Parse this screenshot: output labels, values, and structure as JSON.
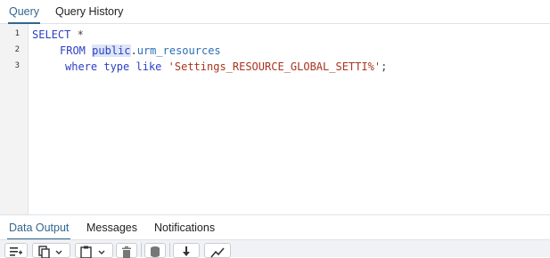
{
  "tabs": {
    "query": "Query",
    "query_history": "Query History"
  },
  "editor": {
    "line_numbers": [
      "1",
      "2",
      "3"
    ],
    "line1": {
      "kw": "SELECT",
      "rest": " *"
    },
    "line2": {
      "kw": "FROM",
      "schema": "public",
      "dot": ".",
      "table": "urm_resources"
    },
    "line3": {
      "kw_where": "where",
      "col": "type",
      "kw_like": "like",
      "string": "'Settings_RESOURCE_GLOBAL_SETTI%'",
      "semicolon": ";"
    }
  },
  "output_tabs": {
    "data_output": "Data Output",
    "messages": "Messages",
    "notifications": "Notifications"
  },
  "toolbar": {
    "icons": [
      "add-row-icon",
      "copy-icon",
      "paste-icon",
      "delete-icon",
      "save-data-icon",
      "download-icon",
      "graph-icon"
    ]
  },
  "colors": {
    "accent": "#326690",
    "keyword": "#2c3fc4",
    "string": "#a8341e",
    "identifier": "#2d6fb5"
  }
}
